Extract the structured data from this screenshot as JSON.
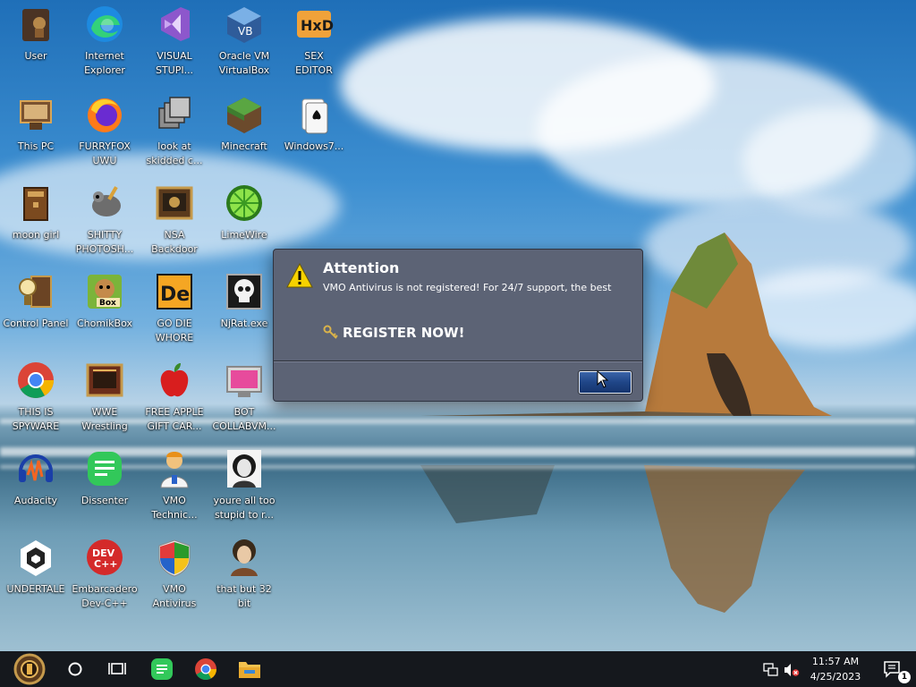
{
  "desktop": {
    "icons": [
      {
        "label": "User",
        "icon": "user-folder-icon"
      },
      {
        "label": "Internet\nExplorer",
        "icon": "edge-browser-icon"
      },
      {
        "label": "VISUAL\nSTUPI...",
        "icon": "visual-studio-icon"
      },
      {
        "label": "Oracle VM\nVirtualBox",
        "icon": "virtualbox-icon"
      },
      {
        "label": "SEX\nEDITOR",
        "icon": "hxd-hex-editor-icon"
      },
      {
        "label": "This PC",
        "icon": "this-pc-icon"
      },
      {
        "label": "FURRYFOX\nUWU",
        "icon": "firefox-icon"
      },
      {
        "label": "look at\nskidded c...",
        "icon": "stacked-windows-icon"
      },
      {
        "label": "Minecraft",
        "icon": "minecraft-icon"
      },
      {
        "label": "Windows7...",
        "icon": "solitaire-cards-icon"
      },
      {
        "label": "moon girl",
        "icon": "wooden-box-icon"
      },
      {
        "label": "SHITTY\nPHOTOSH...",
        "icon": "gimp-icon"
      },
      {
        "label": "NSA\nBackdoor",
        "icon": "steampunk-display-icon"
      },
      {
        "label": "LimeWire",
        "icon": "limewire-icon"
      },
      {
        "label": "Control Panel",
        "icon": "control-panel-icon"
      },
      {
        "label": "ChomikBox",
        "icon": "chomikbox-icon"
      },
      {
        "label": "GO DIE\nWHORE",
        "icon": "de-logo-icon"
      },
      {
        "label": "NjRat.exe",
        "icon": "skull-icon"
      },
      {
        "label": "THIS IS\nSPYWARE",
        "icon": "chrome-icon"
      },
      {
        "label": "WWE\nWrestling",
        "icon": "steampunk-frame-icon"
      },
      {
        "label": "FREE APPLE\nGIFT CAR...",
        "icon": "apple-icon"
      },
      {
        "label": "BOT\nCOLLABVM...",
        "icon": "pink-screen-icon"
      },
      {
        "label": "Audacity",
        "icon": "audacity-icon"
      },
      {
        "label": "Dissenter",
        "icon": "dissenter-icon"
      },
      {
        "label": "VMO\nTechnic...",
        "icon": "technician-icon"
      },
      {
        "label": "youre all too\nstupid to r...",
        "icon": "portrait-photo-icon"
      },
      {
        "label": "UNDERTALE",
        "icon": "unity-icon"
      },
      {
        "label": "Embarcadero\nDev-C++",
        "icon": "devcpp-icon"
      },
      {
        "label": "VMO\nAntivirus",
        "icon": "security-shield-icon"
      },
      {
        "label": "that but 32\nbit",
        "icon": "portrait-lady-icon"
      }
    ]
  },
  "dialog": {
    "title": "Attention",
    "message": "VMO Antivirus is not registered! For 24/7 support, the best",
    "register_label": "REGISTER NOW!",
    "ok_label": ""
  },
  "taskbar": {
    "time": "11:57 AM",
    "date": "4/25/2023",
    "notification_count": "1"
  },
  "colors": {
    "dialog_bg": "#5c6375",
    "taskbar_bg": "#15181d",
    "button_blue": "#1f4587"
  }
}
